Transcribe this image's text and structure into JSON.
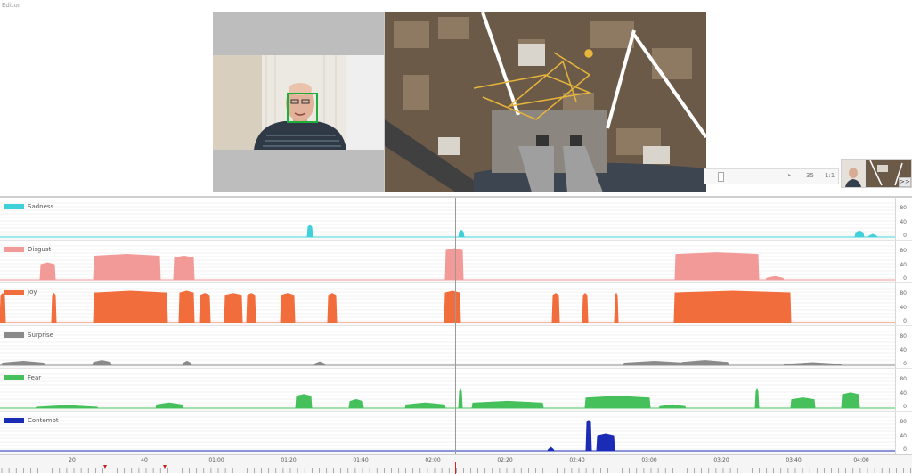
{
  "window": {
    "title": "Editor"
  },
  "player": {
    "speed": "35",
    "ratio": "1:1",
    "expand_label": ">>"
  },
  "channels": [
    {
      "name": "Sadness",
      "color": "#3fd0da",
      "scale": [
        "80",
        "40",
        "0"
      ]
    },
    {
      "name": "Disgust",
      "color": "#f19a98",
      "scale": [
        "80",
        "40",
        "0"
      ]
    },
    {
      "name": "Joy",
      "color": "#f26d3c",
      "scale": [
        "80",
        "40",
        "0"
      ]
    },
    {
      "name": "Surprise",
      "color": "#8a8a8a",
      "scale": [
        "80",
        "40",
        "0"
      ]
    },
    {
      "name": "Fear",
      "color": "#45c05a",
      "scale": [
        "80",
        "40",
        "0"
      ]
    },
    {
      "name": "Contempt",
      "color": "#1a2bb6",
      "scale": [
        "80",
        "40",
        "0"
      ]
    }
  ],
  "timeline": {
    "ticks": [
      "20",
      "40",
      "01:00",
      "01:20",
      "01:40",
      "02:00",
      "02:20",
      "02:40",
      "03:00",
      "03:20",
      "03:40",
      "04:00"
    ],
    "playhead_color": "#e02020"
  }
}
